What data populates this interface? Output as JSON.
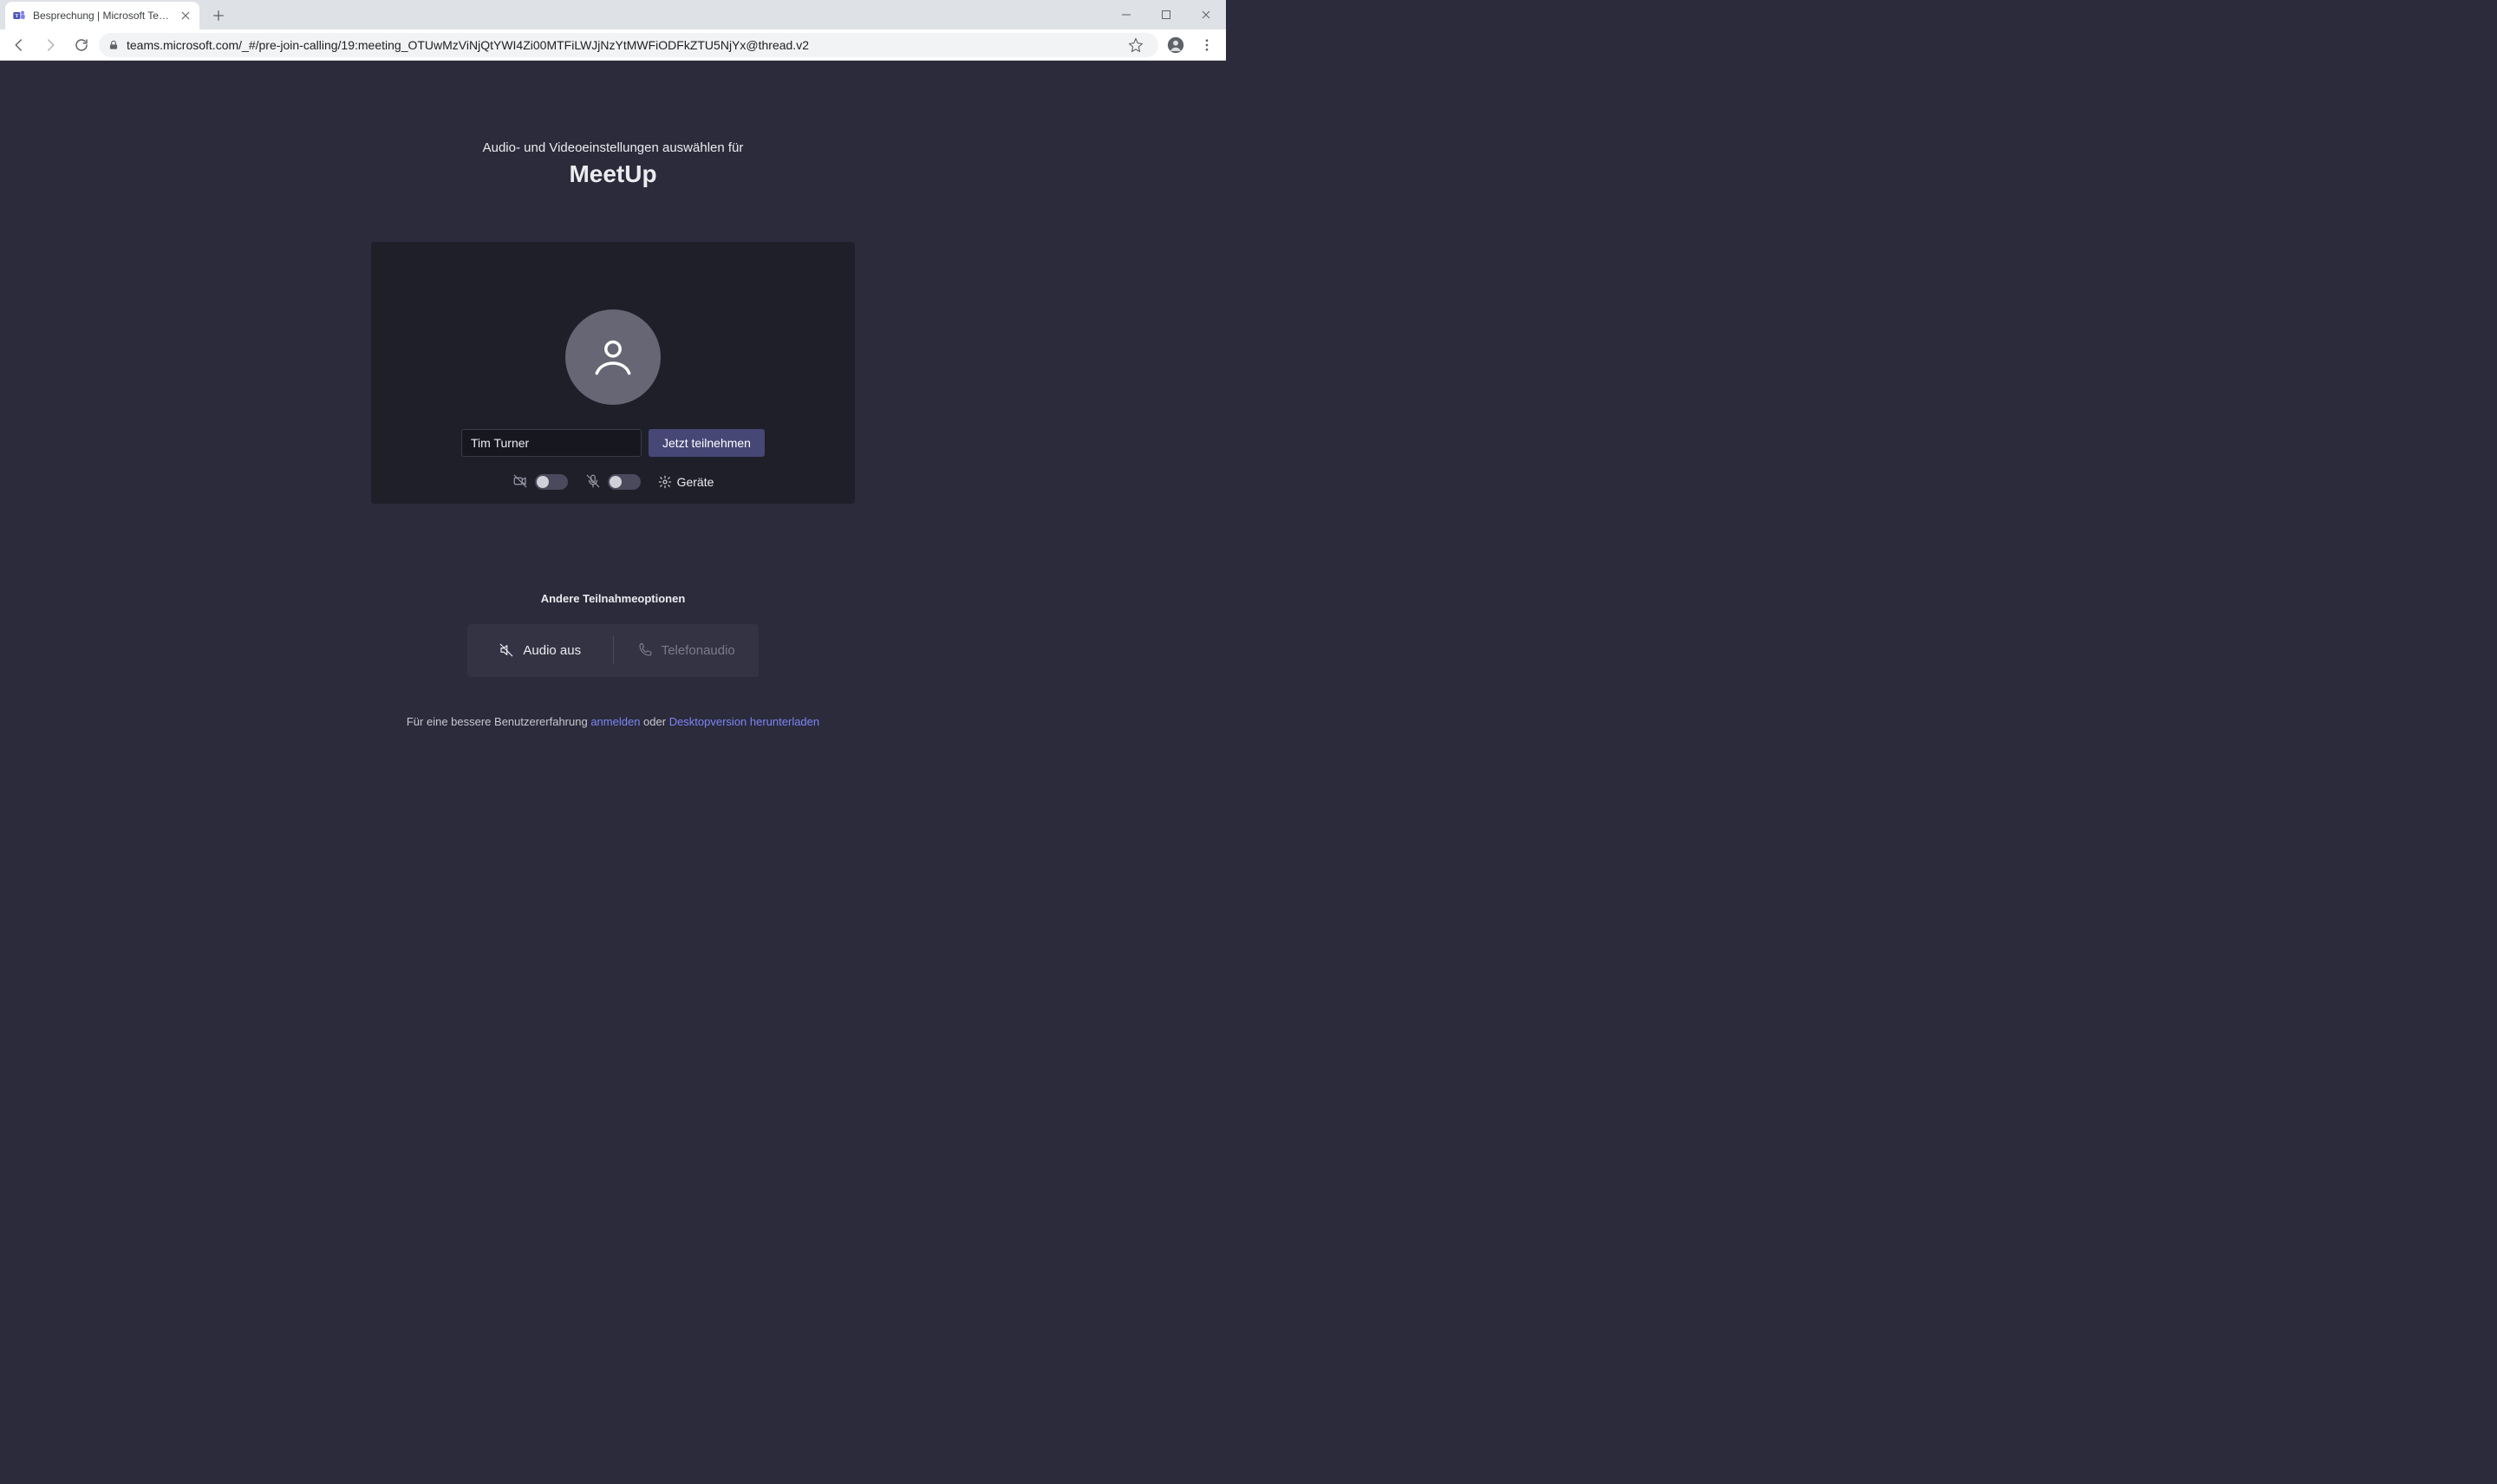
{
  "browser": {
    "tab_title": "Besprechung | Microsoft Teams",
    "url": "teams.microsoft.com/_#/pre-join-calling/19:meeting_OTUwMzViNjQtYWI4Zi00MTFiLWJjNzYtMWFiODFkZTU5NjYx@thread.v2"
  },
  "prejoin": {
    "subtitle": "Audio- und Videoeinstellungen auswählen für",
    "title": "MeetUp",
    "name_value": "Tim Turner",
    "join_label": "Jetzt teilnehmen",
    "devices_label": "Geräte",
    "camera_on": false,
    "mic_on": false
  },
  "other_options": {
    "title": "Andere Teilnahmeoptionen",
    "audio_off_label": "Audio aus",
    "phone_audio_label": "Telefonaudio"
  },
  "footer": {
    "prefix": "Für eine bessere Benutzererfahrung ",
    "login_link": "anmelden",
    "middle": " oder ",
    "download_link": "Desktopversion herunterladen"
  }
}
